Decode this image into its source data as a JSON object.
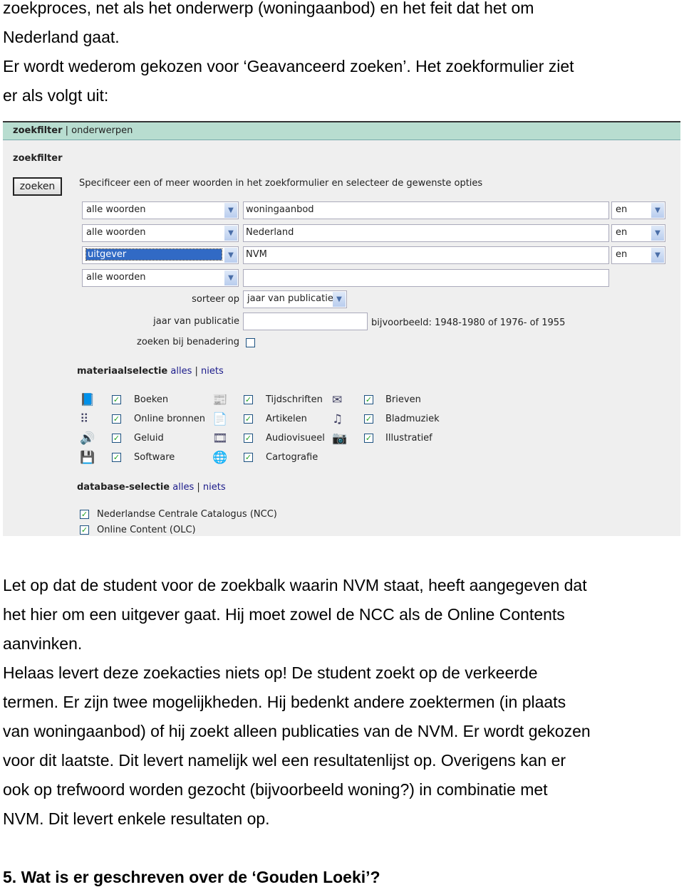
{
  "intro_lines": [
    "zoekproces, net als het onderwerp (woningaanbod) en het feit dat het om",
    "Nederland gaat.",
    "Er wordt wederom gekozen voor ‘Geavanceerd zoeken’. Het zoekformulier ziet",
    "er als volgt uit:"
  ],
  "panel": {
    "tab_active": "zoekfilter",
    "tab_sep": "|",
    "tab_other": "onderwerpen",
    "heading": "zoekfilter",
    "search_button": "zoeken",
    "instruction": "Specificeer een of meer woorden in het zoekformulier en selecteer de gewenste opties",
    "rows": [
      {
        "field": "alle woorden",
        "value": "woningaanbod",
        "op": "en"
      },
      {
        "field": "alle woorden",
        "value": "Nederland",
        "op": "en"
      },
      {
        "field": "uitgever",
        "value": "NVM",
        "op": "en"
      },
      {
        "field": "alle woorden",
        "value": ""
      }
    ],
    "sort_label": "sorteer op",
    "sort_value": "jaar van publicatie",
    "year_label": "jaar van publicatie",
    "year_value": "",
    "year_hint": "bijvoorbeeld: 1948-1980 of 1976- of 1955",
    "approx_label": "zoeken bij benadering",
    "approx_checked": false,
    "material_heading": "materiaalselectie",
    "all": "alles",
    "sep": "|",
    "none": "niets",
    "materials": [
      {
        "label": "Boeken",
        "icon": "book-icon",
        "checked": true
      },
      {
        "label": "Tijdschriften",
        "icon": "magazine-icon",
        "checked": true
      },
      {
        "label": "Brieven",
        "icon": "envelope-icon",
        "checked": true
      },
      {
        "label": "Online bronnen",
        "icon": "binary-data-icon",
        "checked": true
      },
      {
        "label": "Artikelen",
        "icon": "document-icon",
        "checked": true
      },
      {
        "label": "Bladmuziek",
        "icon": "sheet-music-icon",
        "checked": true
      },
      {
        "label": "Geluid",
        "icon": "speaker-icon",
        "checked": true
      },
      {
        "label": "Audiovisueel",
        "icon": "film-icon",
        "checked": true
      },
      {
        "label": "Illustratief",
        "icon": "camera-icon",
        "checked": true
      },
      {
        "label": "Software",
        "icon": "floppy-disk-icon",
        "checked": true
      },
      {
        "label": "Cartografie",
        "icon": "globe-icon",
        "checked": true
      }
    ],
    "database_heading": "database-selectie",
    "databases": [
      {
        "label": "Nederlandse Centrale Catalogus (NCC)",
        "checked": true
      },
      {
        "label": "Online Content (OLC)",
        "checked": true
      }
    ]
  },
  "body_lines": [
    "Let op dat de student voor de zoekbalk waarin NVM staat, heeft aangegeven dat",
    "het hier om een uitgever gaat. Hij moet zowel de NCC als de Online Contents",
    "aanvinken.",
    "Helaas levert deze zoekacties niets op! De student zoekt op de verkeerde",
    "termen. Er zijn twee mogelijkheden. Hij bedenkt andere zoektermen (in plaats",
    "van woningaanbod) of hij zoekt alleen publicaties van de NVM. Er wordt gekozen",
    "voor dit laatste. Dit levert namelijk wel een resultatenlijst op. Overigens kan er",
    "ook op trefwoord worden gezocht (bijvoorbeeld woning?) in combinatie met",
    "NVM. Dit levert enkele resultaten op."
  ],
  "question": "5.  Wat is er geschreven over de ‘Gouden Loeki’?"
}
